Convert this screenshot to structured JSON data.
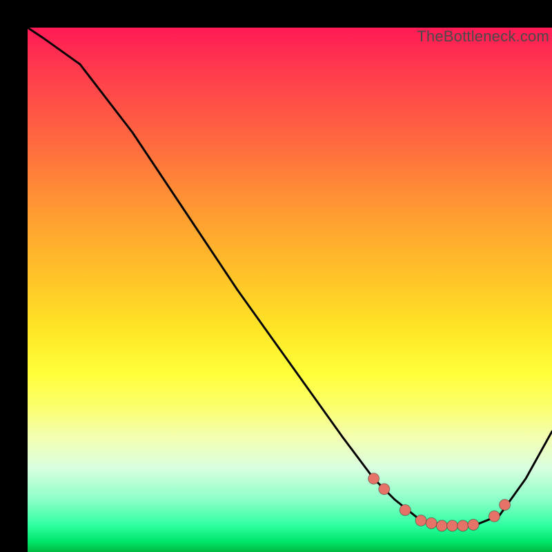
{
  "watermark": "TheBottleneck.com",
  "chart_data": {
    "type": "line",
    "title": "",
    "xlabel": "",
    "ylabel": "",
    "xlim": [
      0,
      100
    ],
    "ylim": [
      0,
      100
    ],
    "grid": false,
    "legend": false,
    "series": [
      {
        "name": "curve",
        "x": [
          0,
          3,
          10,
          20,
          30,
          40,
          50,
          60,
          66,
          70,
          75,
          80,
          85,
          90,
          95,
          100
        ],
        "values": [
          100,
          98,
          93,
          80,
          65,
          50,
          36,
          22,
          14,
          10,
          6,
          5,
          5,
          7,
          14,
          23
        ],
        "color": "#000000"
      }
    ],
    "markers": {
      "name": "highlight-dots",
      "color": "#e57368",
      "x": [
        66,
        68,
        72,
        75,
        77,
        79,
        81,
        83,
        85,
        89,
        91
      ],
      "values": [
        14,
        12,
        8,
        6,
        5.5,
        5,
        5,
        5,
        5.2,
        6.8,
        9
      ]
    },
    "background_gradient": {
      "direction": "vertical",
      "stops": [
        {
          "pos": 0,
          "color": "#ff1a55"
        },
        {
          "pos": 35,
          "color": "#ff9a32"
        },
        {
          "pos": 66,
          "color": "#ffff3a"
        },
        {
          "pos": 90,
          "color": "#8cffc8"
        },
        {
          "pos": 100,
          "color": "#00b842"
        }
      ]
    }
  }
}
